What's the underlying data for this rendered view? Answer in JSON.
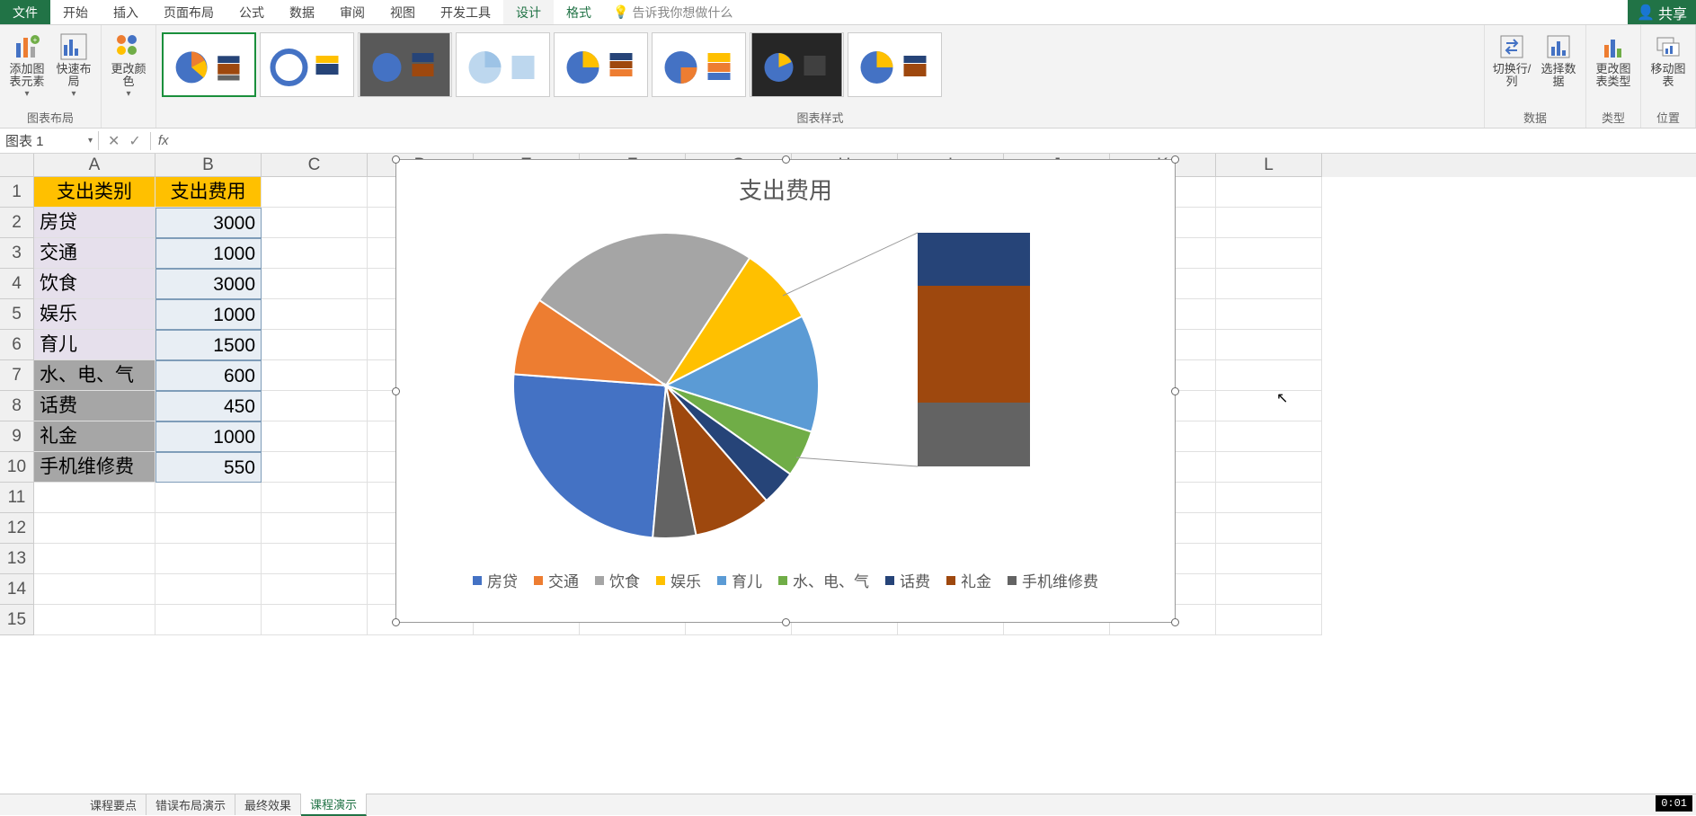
{
  "ribbon": {
    "tabs": [
      "文件",
      "开始",
      "插入",
      "页面布局",
      "公式",
      "数据",
      "审阅",
      "视图",
      "开发工具",
      "设计",
      "格式"
    ],
    "tell_me": "告诉我你想做什么",
    "share": "共享",
    "groups": {
      "layout_label": "图表布局",
      "add_element": "添加图表元素",
      "quick_layout": "快速布局",
      "change_color": "更改颜色",
      "styles_label": "图表样式",
      "switch_rc": "切换行/列",
      "select_data": "选择数据",
      "data_label": "数据",
      "change_type": "更改图表类型",
      "type_label": "类型",
      "move_chart": "移动图表",
      "location_label": "位置"
    }
  },
  "formula_bar": {
    "name_box": "图表 1",
    "fx": "fx"
  },
  "columns": [
    "A",
    "B",
    "C",
    "D",
    "E",
    "F",
    "G",
    "H",
    "I",
    "J",
    "K",
    "L"
  ],
  "table": {
    "headers": [
      "支出类别",
      "支出费用"
    ],
    "rows": [
      {
        "cat": "房贷",
        "val": "3000",
        "shade": "a"
      },
      {
        "cat": "交通",
        "val": "1000",
        "shade": "a"
      },
      {
        "cat": "饮食",
        "val": "3000",
        "shade": "a"
      },
      {
        "cat": "娱乐",
        "val": "1000",
        "shade": "a"
      },
      {
        "cat": "育儿",
        "val": "1500",
        "shade": "a"
      },
      {
        "cat": "水、电、气",
        "val": "600",
        "shade": "a2"
      },
      {
        "cat": "话费",
        "val": "450",
        "shade": "a2"
      },
      {
        "cat": "礼金",
        "val": "1000",
        "shade": "a2"
      },
      {
        "cat": "手机维修费",
        "val": "550",
        "shade": "a2"
      }
    ]
  },
  "chart_data": {
    "type": "pie",
    "title": "支出费用",
    "categories": [
      "房贷",
      "交通",
      "饮食",
      "娱乐",
      "育儿",
      "水、电、气",
      "话费",
      "礼金",
      "手机维修费"
    ],
    "values": [
      3000,
      1000,
      3000,
      1000,
      1500,
      600,
      450,
      1000,
      550
    ],
    "colors": [
      "#4472c4",
      "#ed7d31",
      "#a5a5a5",
      "#ffc000",
      "#5b9bd5",
      "#70ad47",
      "#264478",
      "#9e480e",
      "#636363"
    ],
    "secondary_bar": {
      "categories": [
        "话费",
        "礼金",
        "手机维修费"
      ],
      "values": [
        450,
        1000,
        550
      ]
    }
  },
  "sheet_tabs": [
    "课程要点",
    "错误布局演示",
    "最终效果",
    "课程演示"
  ],
  "timer": "0:01"
}
